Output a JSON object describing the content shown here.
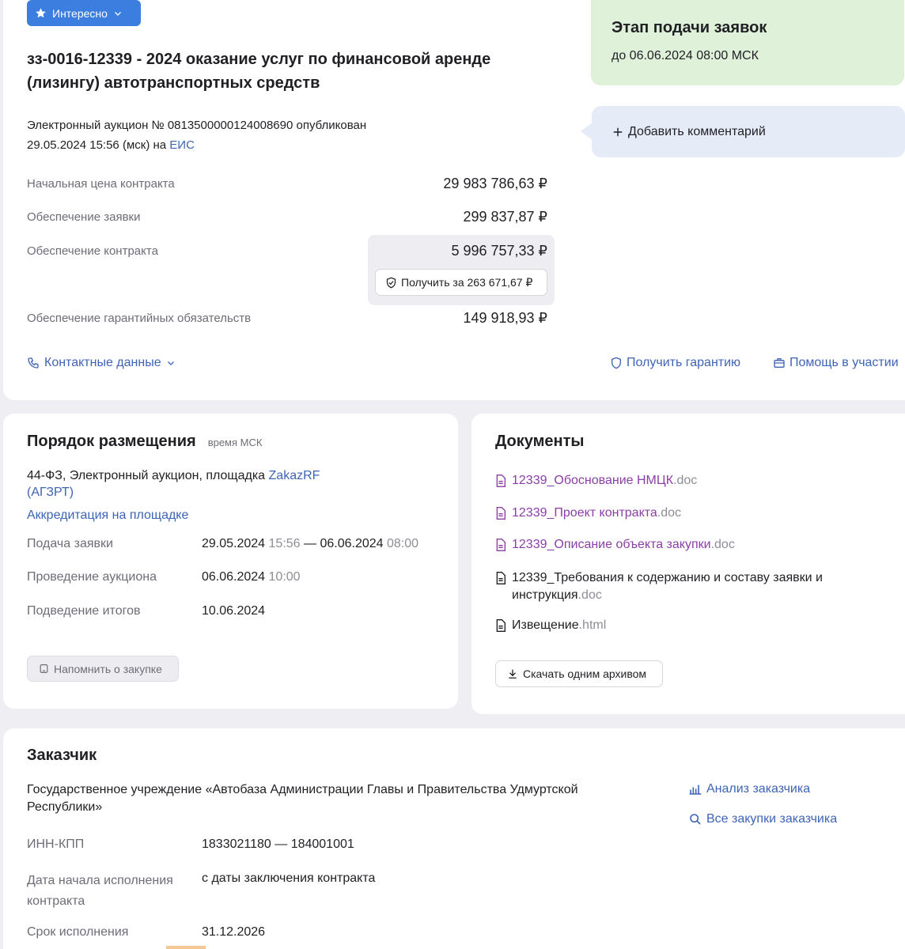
{
  "tag_button": "Интересно",
  "title": "зз-0016-12339 - 2024 оказание услуг по финансовой аренде (лизингу) автотранспортных средств",
  "published": {
    "line1": "Электронный аукцион № 0813500000124008690 опубликован",
    "line2": "29.05.2024 15:56 (мск) на",
    "eis_link": "ЕИС"
  },
  "prices": [
    {
      "label": "Начальная цена контракта",
      "value": "29 983 786,63 ₽"
    },
    {
      "label": "Обеспечение заявки",
      "value": "299 837,87 ₽"
    },
    {
      "label": "Обеспечение контракта",
      "value": "5 996 757,33 ₽"
    },
    {
      "label": "Обеспечение гарантийных обязательств",
      "value": "149 918,93 ₽"
    }
  ],
  "guarantee_button": "Получить за 263 671,67 ₽",
  "contacts_link": "Контактные данные",
  "get_guarantee_link": "Получить гарантию",
  "help_link": "Помощь в участии",
  "stage": {
    "title": "Этап подачи заявок",
    "deadline": "до 06.06.2024 08:00 МСК"
  },
  "add_comment": "Добавить комментарий",
  "placement": {
    "title": "Порядок размещения",
    "tz": "время МСК",
    "law_text": "44-ФЗ, Электронный аукцион, площадка",
    "platform_link_1": "ZakazRF",
    "platform_link_2": "(АГЗРТ)",
    "accreditation": "Аккредитация на площадке",
    "rows": [
      {
        "label": "Подача заявки",
        "d1": "29.05.2024",
        "t1": "15:56",
        "sep": "—",
        "d2": "06.06.2024",
        "t2": "08:00"
      },
      {
        "label": "Проведение аукциона",
        "d1": "06.06.2024",
        "t1": "10:00"
      },
      {
        "label": "Подведение итогов",
        "d1": "10.06.2024"
      }
    ],
    "remind_button": "Напомнить о закупке"
  },
  "documents": {
    "title": "Документы",
    "items": [
      {
        "name": "12339_Обоснование НМЦК",
        "ext": ".doc"
      },
      {
        "name": "12339_Проект контракта",
        "ext": ".doc"
      },
      {
        "name": "12339_Описание объекта закупки",
        "ext": ".doc"
      },
      {
        "name_line1": "12339_Требования к содержанию и составу заявки и",
        "name_line2": "инструкция",
        "ext": ".doc"
      },
      {
        "name": "Извещение",
        "ext": ".html"
      }
    ],
    "archive_button": "Скачать одним архивом"
  },
  "customer": {
    "title": "Заказчик",
    "name_line1": "Государственное учреждение «Автобаза Администрации Главы и Правительства Удмуртской",
    "name_line2": "Республики»",
    "analysis_link": "Анализ заказчика",
    "all_purchases_link": "Все закупки заказчика",
    "rows": [
      {
        "label": "ИНН-КПП",
        "value": "1833021180 — 184001001"
      },
      {
        "label_line1": "Дата начала исполнения",
        "label_line2": "контракта",
        "value": "с даты заключения контракта"
      },
      {
        "label": "Срок исполнения",
        "value": "31.12.2026"
      }
    ]
  }
}
